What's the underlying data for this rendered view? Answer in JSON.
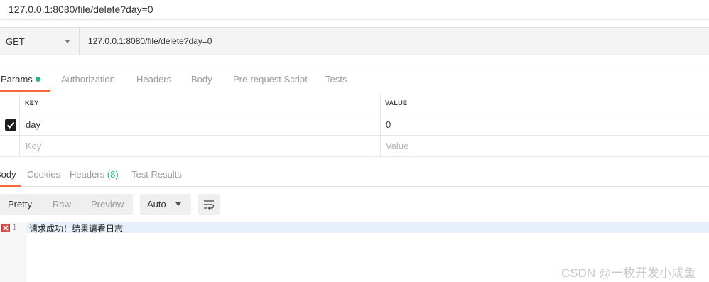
{
  "window": {
    "title": "127.0.0.1:8080/file/delete?day=0"
  },
  "request": {
    "method": "GET",
    "url": "127.0.0.1:8080/file/delete?day=0"
  },
  "request_tabs": [
    {
      "label": "Params",
      "active": true
    },
    {
      "label": "Authorization"
    },
    {
      "label": "Headers"
    },
    {
      "label": "Body"
    },
    {
      "label": "Pre-request Script"
    },
    {
      "label": "Tests"
    }
  ],
  "params_table": {
    "headers": [
      "KEY",
      "VALUE"
    ],
    "rows": [
      {
        "checked": true,
        "key": "day",
        "value": "0"
      }
    ],
    "new_row": {
      "key_placeholder": "Key",
      "value_placeholder": "Value"
    }
  },
  "response_tabs": [
    {
      "label": "Body",
      "active": true
    },
    {
      "label": "Cookies"
    },
    {
      "label": "Headers",
      "count": "(8)"
    },
    {
      "label": "Test Results"
    }
  ],
  "response_toolbar": {
    "views": [
      "Pretty",
      "Raw",
      "Preview"
    ],
    "active_view": "Pretty",
    "format": "Auto"
  },
  "response_body": {
    "line_number": "1",
    "text": "请求成功！结果请看日志"
  },
  "watermark": "CSDN @一枚开发小咸鱼",
  "colors": {
    "accent": "#f26b3a",
    "success": "#26b47f",
    "error": "#d9534f"
  }
}
